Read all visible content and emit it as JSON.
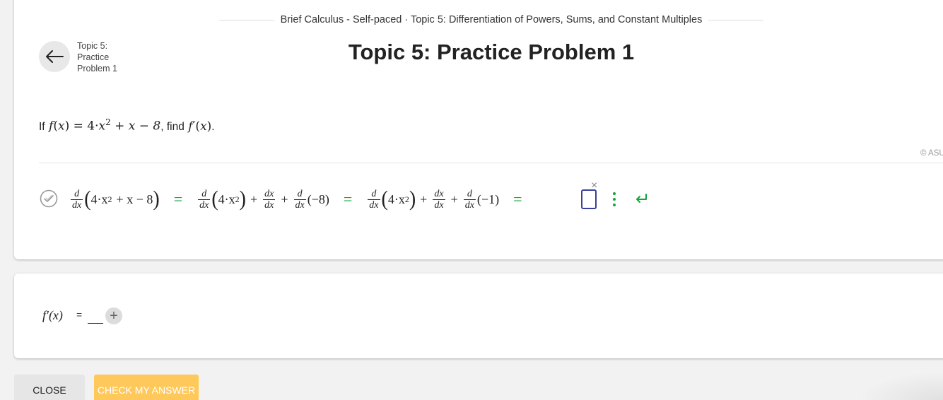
{
  "header": {
    "breadcrumb": "Brief Calculus - Self-paced · Topic 5: Differentiation of Powers, Sums, and Constant Multiples",
    "back_label": "Topic 5: Practice Problem 1",
    "title": "Topic 5: Practice Problem 1"
  },
  "problem": {
    "prefix": "If",
    "function_name": "f",
    "variable": "x",
    "expr_coef": "4",
    "expr_exp": "2",
    "expr_tail": "x − 8",
    "find_text": ", find",
    "target": "f′",
    "suffix": "."
  },
  "copyright": "© ASU",
  "work": {
    "d": "d",
    "dx": "dx",
    "step1_inner": "4·x",
    "step1_exp": "2",
    "step1_tail": "+ x − 8",
    "step2_term1": "4·x",
    "step2_exp": "2",
    "step2_term3": "(−8)",
    "step3_term1": "4·x",
    "step3_exp": "2",
    "step3_term3": "(−1)",
    "plus": "+",
    "equals": "=",
    "close_glyph": "×"
  },
  "answer": {
    "label": "f′(x)",
    "equals": "=",
    "plus_glyph": "+"
  },
  "buttons": {
    "close": "CLOSE",
    "check": "CHECK MY ANSWER"
  },
  "colors": {
    "accent_green": "#17a33b",
    "check_button": "#ffc85a",
    "input_border": "#3a3f9a"
  }
}
